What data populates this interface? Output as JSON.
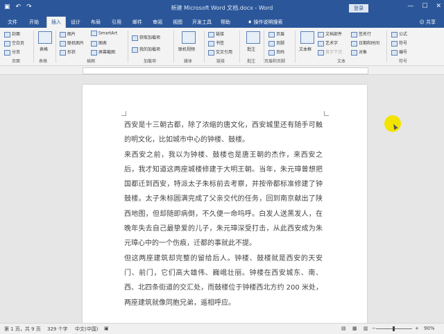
{
  "titlebar": {
    "title": "新建 Microsoft Word 文档.docx  -  Word",
    "login": "登录",
    "qat_save": "▣",
    "qat_undo": "↶",
    "qat_redo": "↷",
    "win_min": "—",
    "win_max": "☐",
    "win_close": "✕"
  },
  "tabs": {
    "items": [
      "文件",
      "开始",
      "插入",
      "设计",
      "布局",
      "引用",
      "邮件",
      "审阅",
      "视图",
      "开发工具",
      "帮助"
    ],
    "tell_me": "操作说明搜索",
    "share": "共享"
  },
  "ribbon": {
    "pages": [
      "封面",
      "空白页",
      "分页"
    ],
    "pages_group": "页面",
    "table": "表格",
    "table_group": "表格",
    "illus": [
      "图片",
      "联机图片",
      "形状",
      "SmartArt",
      "图表",
      "屏幕截图"
    ],
    "illus_group": "插图",
    "addins": [
      "获取加载项",
      "我的加载项"
    ],
    "addins_group": "加载项",
    "media": "联机视频",
    "media_group": "媒体",
    "links": [
      "链接",
      "书签",
      "交叉引用"
    ],
    "links_group": "链接",
    "comment": "批注",
    "comment_group": "批注",
    "header_footer": [
      "页眉",
      "页脚",
      "页码"
    ],
    "hf_group": "页眉和页脚",
    "textbox": "文本框",
    "text_items": [
      "文档部件",
      "艺术字",
      "首字下沉",
      "签名行",
      "日期和时间",
      "对象"
    ],
    "text_group": "文本",
    "symbols": [
      "公式",
      "符号",
      "编号"
    ],
    "symbols_group": "符号"
  },
  "document": {
    "paragraphs": [
      "西安是十三朝古都，除了浓缩的唐文化，西安城里还有随手可触的明文化，比如城市中心的钟楼、鼓楼。",
      "来西安之前，我以为钟楼、鼓楼也是唐王朝的杰作，来西安之后，我才知道这两座城楼修建于大明王朝。当年，朱元璋曾想把国都迁到西安，特派太子朱标前去考察，并按帝都标准修建了钟鼓楼。太子朱标圆满完成了父亲交代的任务，回到南京献出了陕西地图，但却随即病倒，不久便一命呜呼。白发人送黑发人，在晚年失去自己最挚爱的儿子，朱元璋深受打击，从此西安成为朱元璋心中的一个伤痕，迁都的事就此不提。",
      "但这两座建筑却完整的留给后人。钟楼、鼓楼就是西安的天安门、前门，它们高大雄伟、巍峨壮丽。钟楼在西安城东、南、西、北四条街道的交汇处，而鼓楼位于钟楼西北方约 200 米处，两座建筑就像同胞兄弟，遥相呼应。"
    ]
  },
  "statusbar": {
    "page": "第 1 页，共 9 页",
    "words": "329 个字",
    "lang": "中文(中国)",
    "zoom": "90%",
    "zoom_minus": "−",
    "zoom_plus": "+"
  }
}
